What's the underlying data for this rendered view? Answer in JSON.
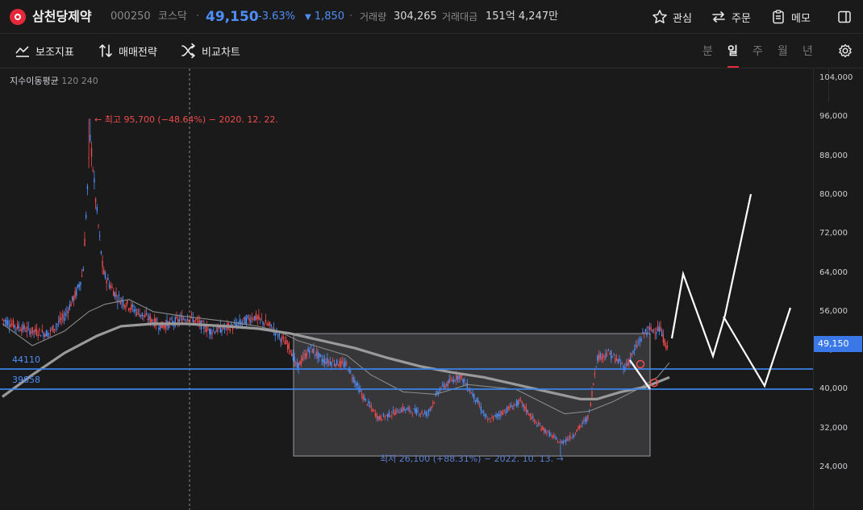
{
  "header": {
    "stock_name": "삼천당제약",
    "stock_code": "000250",
    "market": "코스닥",
    "separator": "·",
    "price": "49,150",
    "change_pct": "-3.63%",
    "change_arrow": "▼",
    "change_value": "1,850",
    "volume_label": "거래량",
    "volume_value": "304,265",
    "amount_label": "거래대금",
    "amount_value": "151억 4,247만",
    "watch_label": "관심",
    "order_label": "주문",
    "memo_label": "메모"
  },
  "toolbar": {
    "indicator_label": "보조지표",
    "strategy_label": "매매전략",
    "compare_label": "비교차트",
    "periods": [
      "분",
      "일",
      "주",
      "월",
      "년"
    ],
    "active_period": "일"
  },
  "chart": {
    "ma_label": "지수이동평균",
    "ma_values": "120 240",
    "y_ticks": [
      "104,000",
      "96,000",
      "88,000",
      "80,000",
      "72,000",
      "64,000",
      "56,000",
      "48,000",
      "40,000",
      "32,000",
      "24,000"
    ],
    "current_price_tag": "49,150",
    "hline_upper_label": "44110",
    "hline_lower_label": "39858",
    "high_annotation": "←  최고 95,700 (−48.64%) − 2020. 12. 22.",
    "low_annotation": "최저 26,100 (+88.31%)  −  2022. 10. 13.  →",
    "colors": {
      "up": "#ef4b4b",
      "down": "#4f8ef7",
      "hline": "#3b82e8",
      "ma_thin": "#8a8a8a",
      "ma_thick": "#9a9a9a",
      "box": "#3a3a3c",
      "drawing": "#ffffff",
      "accent": "#e6283a"
    }
  }
}
